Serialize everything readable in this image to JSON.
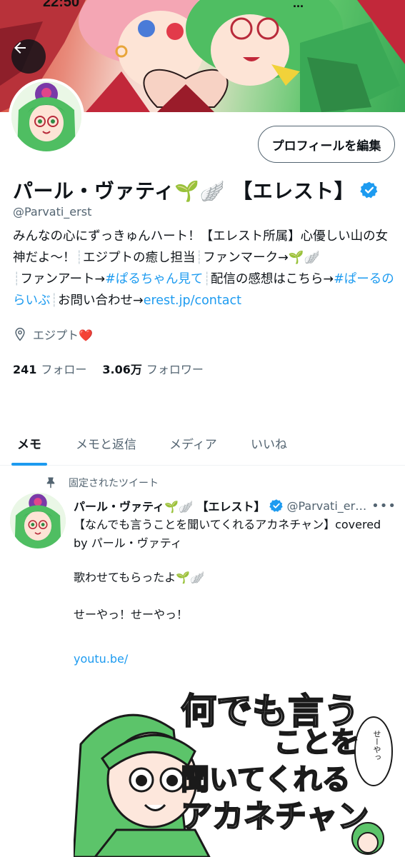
{
  "status_bar": {
    "time": "22:50",
    "signal": "..."
  },
  "header": {
    "back_label": "back"
  },
  "profile": {
    "edit_button": "プロフィールを編集",
    "display_name": "パール・ヴァティ🌱🪽 【エレスト】",
    "handle": "@Parvati_erst",
    "bio": {
      "part1": "みんなの心にずっきゅんハート！【エレスト所属】心優しい山の女神だよ～！",
      "sep": "┊",
      "part2": "エジプトの癒し担当",
      "part3": "ファンマーク→🌱🪽",
      "part4": "ファンアート→",
      "hashtag1": "#ぱるちゃん見て",
      "part5": "配信の感想はこちら→",
      "hashtag2": "#ぱーるのらいぶ",
      "part6": "お問い合わせ→",
      "link": "erest.jp/contact"
    },
    "location": "エジプト❤️",
    "following_count": "241",
    "following_label": "フォロー",
    "followers_count": "3.06万",
    "followers_label": "フォロワー"
  },
  "tabs": [
    {
      "label": "メモ",
      "active": true
    },
    {
      "label": "メモと返信",
      "active": false
    },
    {
      "label": "メディア",
      "active": false
    },
    {
      "label": "いいね",
      "active": false
    }
  ],
  "pinned_tweet": {
    "pinned_label": "固定されたツイート",
    "author_name": "パール・ヴァティ🌱🪽 【エレスト】",
    "author_handle": "@Parvati_erst...",
    "more": "•••",
    "line1": "【なんでも言うことを聞いてくれるアカネチャン】covered by パール・ヴァティ",
    "line2": "歌わせてもらったよ🌱🪽",
    "line3": "せーやっ！せーやっ！",
    "link": "youtu.be/",
    "media_title_lines": [
      "何でも言う",
      "ことを",
      "聞いてくれる",
      "アカネチャン"
    ],
    "media_bubble": "せーやっ"
  },
  "colors": {
    "accent": "#1d9bf0",
    "text": "#0f1419",
    "muted": "#536471",
    "hair_green": "#5cc46a"
  },
  "icons": [
    "back-arrow-icon",
    "verified-badge-icon",
    "location-pin-icon",
    "pin-icon",
    "more-icon"
  ]
}
